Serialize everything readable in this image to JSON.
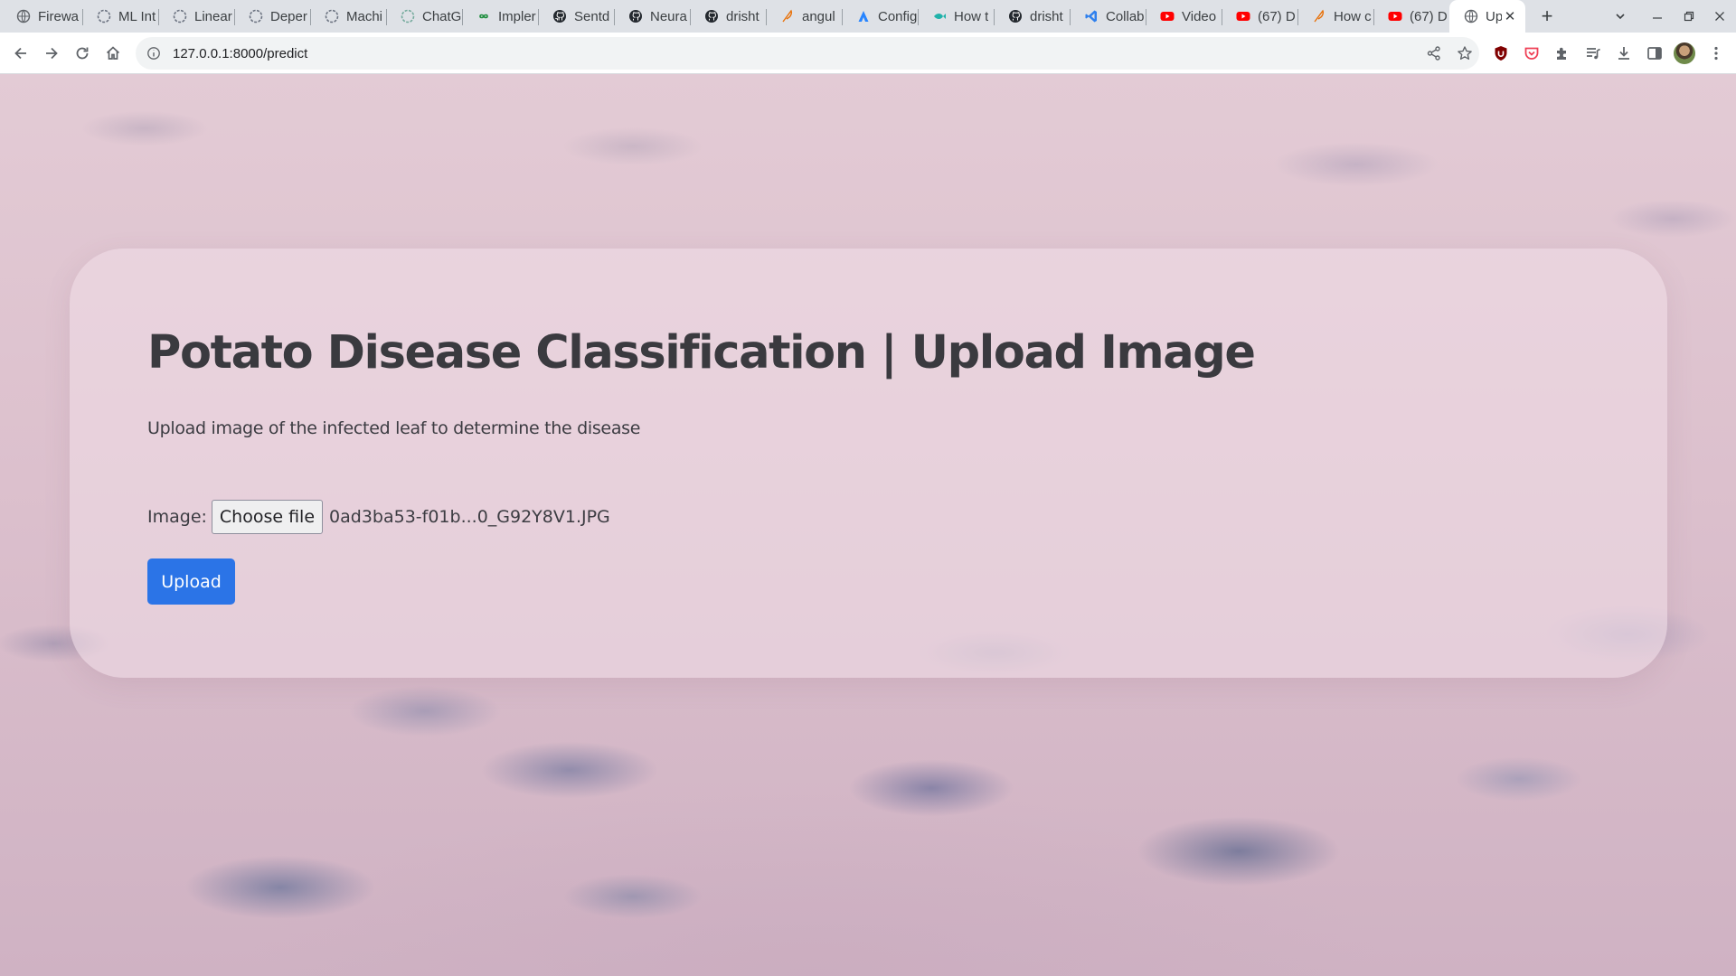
{
  "browser": {
    "tabs": [
      {
        "title": "Firewa",
        "icon": "globe-icon"
      },
      {
        "title": "ML Int",
        "icon": "openai-icon"
      },
      {
        "title": "Linear",
        "icon": "openai-icon"
      },
      {
        "title": "Deper",
        "icon": "openai-icon"
      },
      {
        "title": "Machi",
        "icon": "openai-icon"
      },
      {
        "title": "ChatG",
        "icon": "openai-icon"
      },
      {
        "title": "Impler",
        "icon": "infinity-icon"
      },
      {
        "title": "Sentd",
        "icon": "github-icon"
      },
      {
        "title": "Neura",
        "icon": "github-icon"
      },
      {
        "title": "drisht",
        "icon": "github-icon"
      },
      {
        "title": "angul",
        "icon": "quill-icon"
      },
      {
        "title": "Config",
        "icon": "atlassian-icon"
      },
      {
        "title": "How t",
        "icon": "fish-icon"
      },
      {
        "title": "drisht",
        "icon": "github-icon"
      },
      {
        "title": "Collab",
        "icon": "vscode-icon"
      },
      {
        "title": "Video",
        "icon": "youtube-icon"
      },
      {
        "title": "(67) D",
        "icon": "youtube-icon"
      },
      {
        "title": "How c",
        "icon": "quill-icon"
      },
      {
        "title": "(67) D",
        "icon": "youtube-icon"
      },
      {
        "title": "Up",
        "icon": "globe-icon",
        "active": true
      }
    ],
    "address_bar": {
      "url": "127.0.0.1:8000/predict"
    },
    "colors": {
      "tabstrip": "#dee1e6",
      "youtube": "#ff0000",
      "vscode": "#2f80ed",
      "atlassian": "#2684ff"
    }
  },
  "page": {
    "title": "Potato Disease Classification | Upload Image",
    "subtitle": "Upload image of the infected leaf to determine the disease",
    "form": {
      "image_label": "Image:",
      "choose_file_label": "Choose file",
      "selected_file_name": "0ad3ba53-f01b...0_G92Y8V1.JPG",
      "upload_label": "Upload"
    },
    "colors": {
      "upload_button": "#2b74e7",
      "card_background": "rgba(240,222,232,0.55)"
    }
  }
}
